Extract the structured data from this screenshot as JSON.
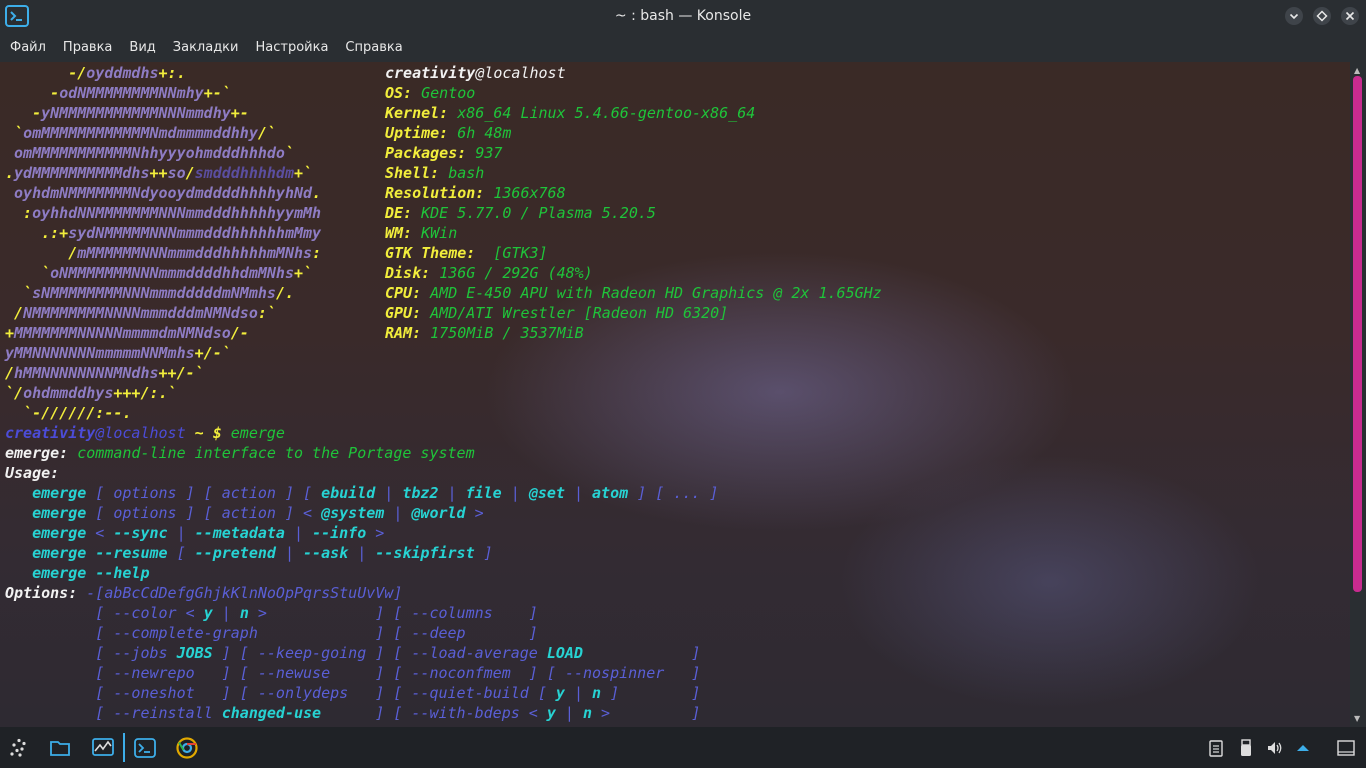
{
  "window": {
    "title": "~ : bash — Konsole"
  },
  "menubar": [
    "Файл",
    "Правка",
    "Вид",
    "Закладки",
    "Настройка",
    "Справка"
  ],
  "terminal": {
    "logo_lines": [
      "       -/oyddmdhs+:.",
      "     -odNMMMMMMMMNNmhy+-`",
      "   -yNMMMMMMMMMMMNNNmmdhy+-",
      " `omMMMMMMMMMMMMNmdmmmmddhhy/`",
      " omMMMMMMMMMMMNhhyyyohmdddhhhdo`",
      ".ydMMMMMMMMMMdhs++so/smdddhhhhdm+`",
      " oyhdmNMMMMMMMNdyooydmddddhhhhyhNd.",
      "  :oyhhdNNMMMMMMMNNNmmdddhhhhhyymMh",
      "    .:+sydNMMMMMNNNmmmdddhhhhhhmMmy",
      "       /mMMMMMMNNNmmmdddhhhhhmMNhs:",
      "    `oNMMMMMMMNNNmmmddddhhdmMNhs+`",
      "  `sNMMMMMMMMNNNmmmdddddmNMmhs/.",
      " /NMMMMMMMMNNNNmmmdddmNMNdso:`",
      "+MMMMMMMNNNNNmmmmdmNMNdso/-",
      "yMMNNNNNNNmmmmmNNMmhs+/-`",
      "/hMMNNNNNNNNMNdhs++/-`",
      "`/ohdmmddhys+++/:.`",
      "  `-//////:--."
    ],
    "info_user": "creativity",
    "info_host": "@localhost",
    "info": [
      {
        "key": "OS:",
        "value": "Gentoo"
      },
      {
        "key": "Kernel:",
        "value": "x86_64 Linux 5.4.66-gentoo-x86_64"
      },
      {
        "key": "Uptime:",
        "value": "6h 48m"
      },
      {
        "key": "Packages:",
        "value": "937"
      },
      {
        "key": "Shell:",
        "value": "bash"
      },
      {
        "key": "Resolution:",
        "value": "1366x768"
      },
      {
        "key": "DE:",
        "value": "KDE 5.77.0 / Plasma 5.20.5"
      },
      {
        "key": "WM:",
        "value": "KWin"
      },
      {
        "key": "GTK Theme:",
        "value": " [GTK3]"
      },
      {
        "key": "Disk:",
        "value": "136G / 292G (48%)"
      },
      {
        "key": "CPU:",
        "value": "AMD E-450 APU with Radeon HD Graphics @ 2x 1.65GHz"
      },
      {
        "key": "GPU:",
        "value": "AMD/ATI Wrestler [Radeon HD 6320]"
      },
      {
        "key": "RAM:",
        "value": "1750MiB / 3537MiB"
      }
    ],
    "prompt_user": "creativity",
    "prompt_host": "@localhost",
    "prompt_path": " ~ $",
    "command": " emerge",
    "output_lines": [
      "emerge: command-line interface to the Portage system",
      "Usage:",
      "   emerge [ options ] [ action ] [ ebuild | tbz2 | file | @set | atom ] [ ... ]",
      "   emerge [ options ] [ action ] < @system | @world >",
      "   emerge < --sync | --metadata | --info >",
      "   emerge --resume [ --pretend | --ask | --skipfirst ]",
      "   emerge --help",
      "Options: -[abBcCdDefgGhjkKlnNoOpPqrsStuUvVw]",
      "          [ --color < y | n >            ] [ --columns    ]",
      "          [ --complete-graph             ] [ --deep       ]",
      "          [ --jobs JOBS ] [ --keep-going ] [ --load-average LOAD            ]",
      "          [ --newrepo   ] [ --newuse     ] [ --noconfmem  ] [ --nospinner   ]",
      "          [ --oneshot   ] [ --onlydeps   ] [ --quiet-build [ y | n ]        ]",
      "          [ --reinstall changed-use      ] [ --with-bdeps < y | n >         ]"
    ]
  },
  "taskbar": {
    "items": [
      "application-launcher-icon",
      "file-manager-icon",
      "system-monitor-icon",
      "konsole-icon",
      "chrome-icon"
    ]
  },
  "tray": [
    "clipboard-icon",
    "usb-device-icon",
    "volume-icon",
    "tray-expand-icon",
    "show-desktop-icon"
  ]
}
